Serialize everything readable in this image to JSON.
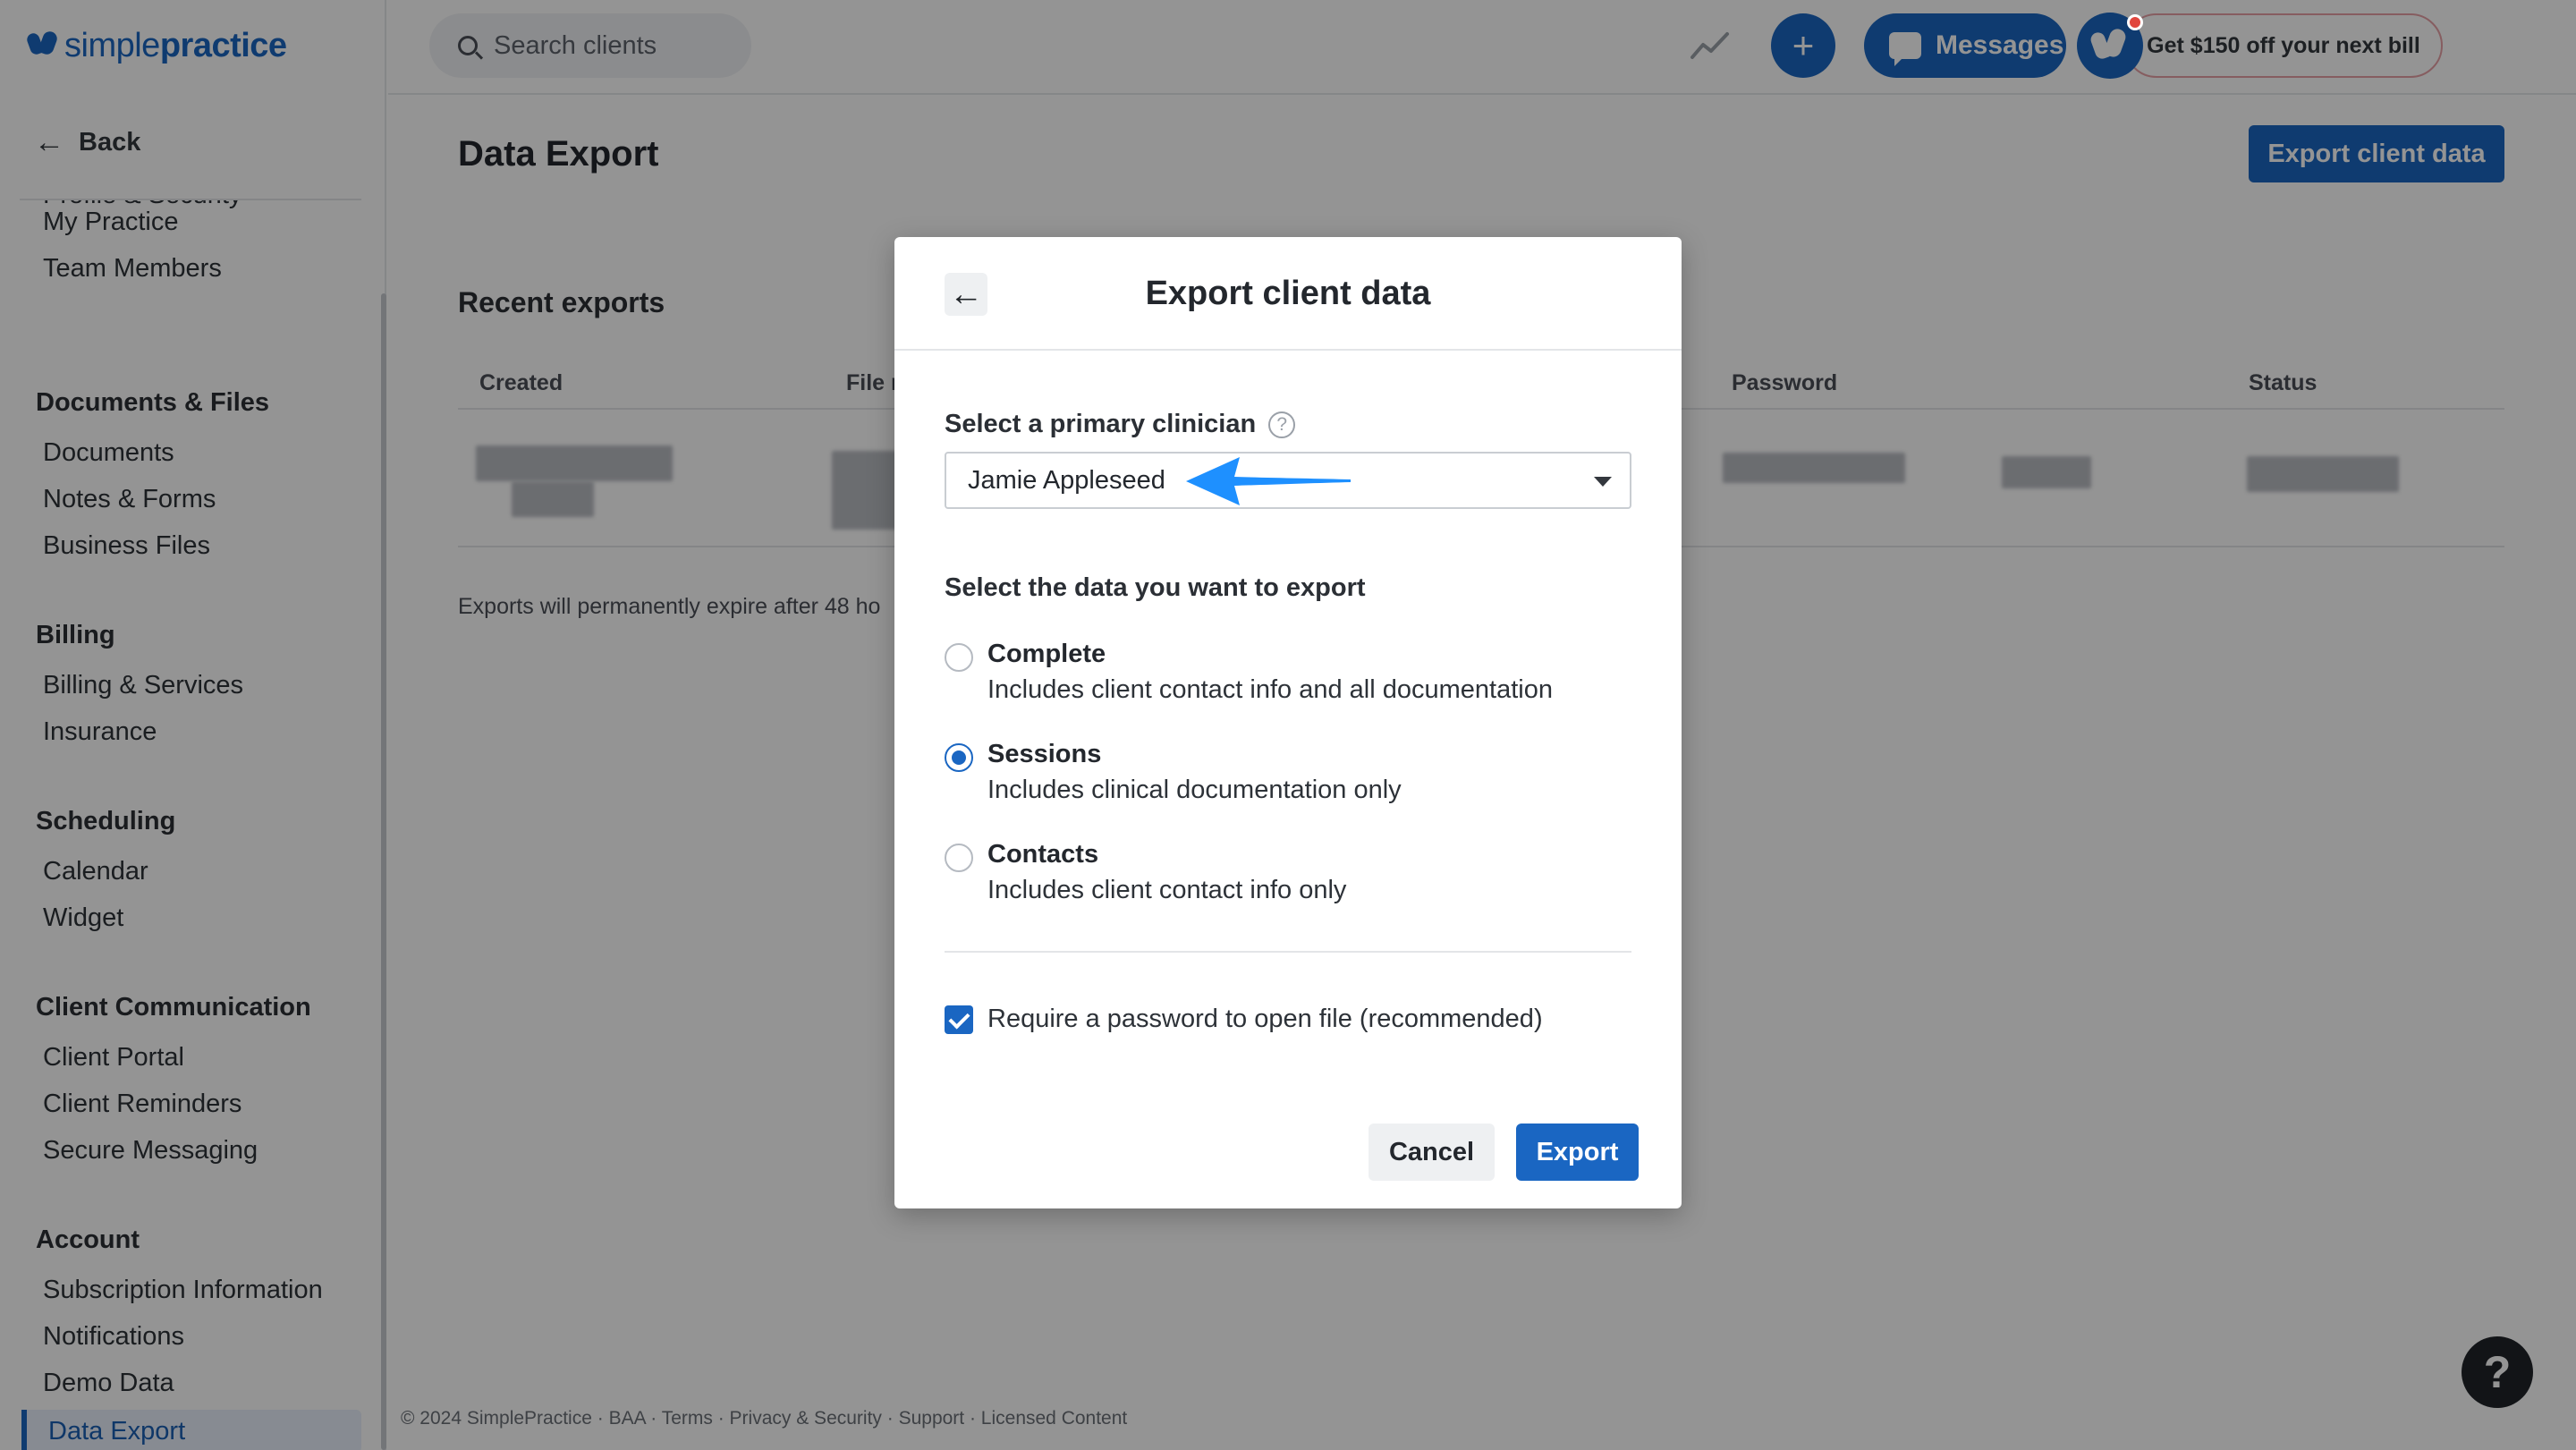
{
  "brand": {
    "name_bold": "simple",
    "name_light": "practice"
  },
  "sidebar": {
    "back_label": "Back",
    "partial_item": "Profile & Security",
    "groups": [
      {
        "items": [
          "My Practice",
          "Team Members"
        ]
      },
      {
        "title": "Documents & Files",
        "items": [
          "Documents",
          "Notes & Forms",
          "Business Files"
        ]
      },
      {
        "title": "Billing",
        "items": [
          "Billing & Services",
          "Insurance"
        ]
      },
      {
        "title": "Scheduling",
        "items": [
          "Calendar",
          "Widget"
        ]
      },
      {
        "title": "Client Communication",
        "items": [
          "Client Portal",
          "Client Reminders",
          "Secure Messaging"
        ]
      },
      {
        "title": "Account",
        "items": [
          "Subscription Information",
          "Notifications",
          "Demo Data",
          "Data Export"
        ]
      }
    ],
    "active_item": "Data Export"
  },
  "topbar": {
    "search_placeholder": "Search clients",
    "messages_label": "Messages",
    "promo_label": "Get $150 off your next bill"
  },
  "main": {
    "page_title": "Data Export",
    "export_button": "Export client data",
    "recent_title": "Recent exports",
    "columns": [
      "Created",
      "File n",
      "Password",
      "Status"
    ],
    "expire_note": "Exports will permanently expire after 48 ho"
  },
  "footer": {
    "text": "© 2024 SimplePractice · BAA · Terms · Privacy & Security · Support · Licensed Content"
  },
  "help_label": "?",
  "modal": {
    "title": "Export client data",
    "clinician_label": "Select a primary clinician",
    "clinician_help": "?",
    "clinician_value": "Jamie Appleseed",
    "data_label": "Select the data you want to export",
    "options": [
      {
        "title": "Complete",
        "desc": "Includes client contact info and all documentation",
        "checked": false
      },
      {
        "title": "Sessions",
        "desc": "Includes clinical documentation only",
        "checked": true
      },
      {
        "title": "Contacts",
        "desc": "Includes client contact info only",
        "checked": false
      }
    ],
    "password_label": "Require a password to open file (recommended)",
    "password_checked": true,
    "cancel_label": "Cancel",
    "export_label": "Export"
  },
  "colors": {
    "primary": "#1a66c2",
    "overlay": "rgba(0,0,0,0.42)",
    "annotation_arrow": "#1e90ff"
  }
}
